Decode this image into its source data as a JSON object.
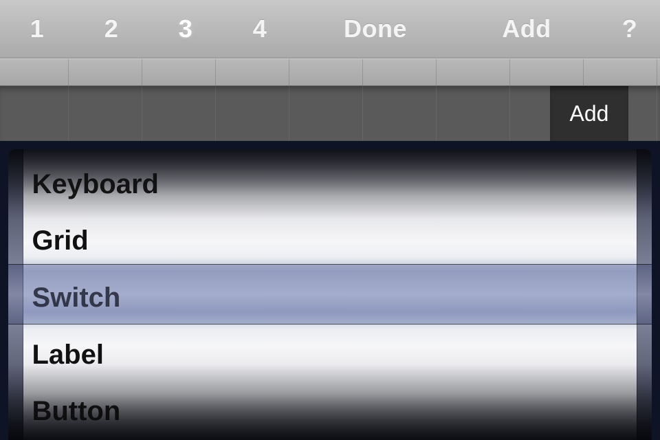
{
  "toolbar": {
    "pages": [
      "1",
      "2",
      "3",
      "4"
    ],
    "active_page_index": 2,
    "done_label": "Done",
    "add_label": "Add",
    "help_label": "?"
  },
  "workspace": {
    "add_chip_label": "Add"
  },
  "picker": {
    "items": [
      "Keyboard",
      "Grid",
      "Switch",
      "Label",
      "Button"
    ],
    "selected_index": 2
  }
}
